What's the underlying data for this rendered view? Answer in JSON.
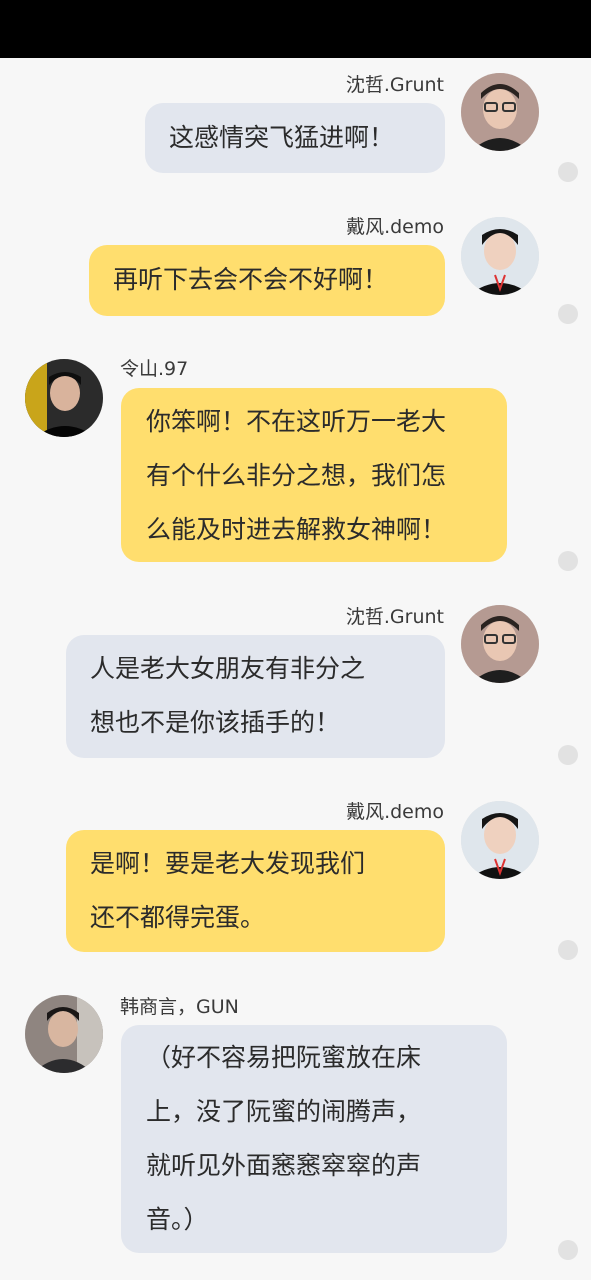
{
  "messages": [
    {
      "name": "沈哲.Grunt",
      "text": "这感情突飞猛进啊！",
      "side": "right",
      "bubble_color": "#e2e6ee",
      "avatar": "glasses-boy-avatar"
    },
    {
      "name": "戴风.demo",
      "text": "再听下去会不会不好啊！",
      "side": "right",
      "bubble_color": "#ffde6e",
      "avatar": "lanyard-boy-avatar"
    },
    {
      "name": "令山.97",
      "text": "你笨啊！不在这听万一老大\n有个什么非分之想，我们怎\n么能及时进去解救女神啊！",
      "side": "left",
      "bubble_color": "#ffde6e",
      "avatar": "dark-boy-avatar"
    },
    {
      "name": "沈哲.Grunt",
      "text": "人是老大女朋友有非分之\n想也不是你该插手的！",
      "side": "right",
      "bubble_color": "#e2e6ee",
      "avatar": "glasses-boy-avatar"
    },
    {
      "name": "戴风.demo",
      "text": "是啊！要是老大发现我们\n还不都得完蛋。",
      "side": "right",
      "bubble_color": "#ffde6e",
      "avatar": "lanyard-boy-avatar"
    },
    {
      "name": "韩商言，GUN",
      "text": "（好不容易把阮蜜放在床\n上，没了阮蜜的闹腾声，\n就听见外面窸窸窣窣的声\n音。）",
      "side": "left",
      "bubble_color": "#e2e6ee",
      "avatar": "jacket-boy-avatar"
    }
  ]
}
